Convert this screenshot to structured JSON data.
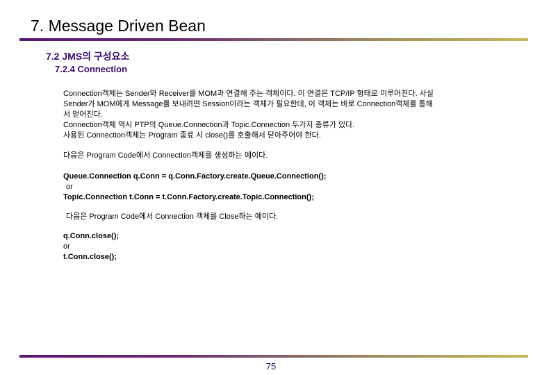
{
  "slide": {
    "title": "7. Message Driven Bean",
    "section": "7.2 JMS의 구성요소",
    "subsection": "7.2.4 Connection",
    "description_lines": [
      "Connection객체는 Sender와 Receiver를 MOM과 연결해 주는 객체이다. 이 연결은 TCP/IP 형태로 이루어진다. 사실",
      "Sender가 MOM에게 Message를 보내려면 Session이라는 객체가 필요한데, 이 객체는 바로 Connection객체를 통해",
      "서 얻어진다.",
      "Connection객체 역시 PTP의 Queue.Connection과 Topic.Connection 두가지 종류가 있다.",
      "사용된 Connection객체는 Program 종료 시 close()를 호출해서 닫아주어야 한다."
    ],
    "create_intro": "다음은 Program Code에서 Connection객체를 생성하는 예이다.",
    "create_code": {
      "queue": "Queue.Connection q.Conn = q.Conn.Factory.create.Queue.Connection();",
      "or": "or",
      "topic": "Topic.Connection t.Conn = t.Conn.Factory.create.Topic.Connection();"
    },
    "close_intro": "다음은 Program Code에서 Connection 객체를 Close하는 예이다.",
    "close_code": {
      "queue": "q.Conn.close();",
      "or": "or",
      "topic": "t.Conn.close();"
    },
    "page_number": "75"
  },
  "colors": {
    "heading": "#3a0a6e",
    "rule_start": "#5a1770",
    "rule_end": "#c9b85a"
  }
}
